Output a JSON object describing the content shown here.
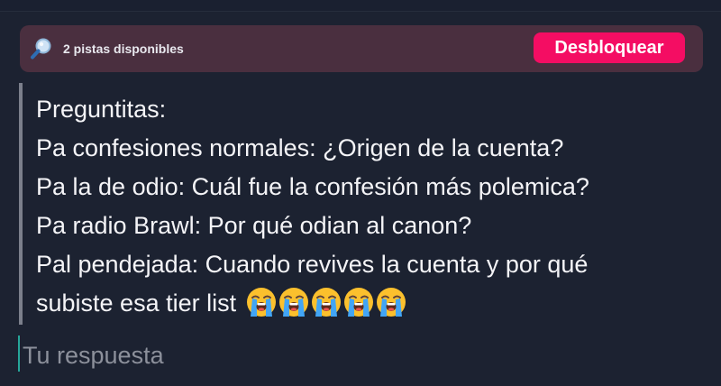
{
  "hints": {
    "icon": "magnifying-glass-icon",
    "label": "2 pistas disponibles",
    "unlock_label": "Desbloquear"
  },
  "question": {
    "lines": [
      "Preguntitas:",
      "Pa confesiones normales: ¿Origen de la cuenta?",
      "Pa la de odio: Cuál fue la confesión más polemica?",
      "Pa radio Brawl: Por qué odian al canon?",
      "Pal pendejada: Cuando revives la cuenta y por qué",
      "subiste esa tier list"
    ],
    "trailing_emoji": "loudly-crying-face-emoji",
    "trailing_emoji_count": 5
  },
  "answer": {
    "value": "",
    "placeholder": "Tu respuesta"
  },
  "colors": {
    "background": "#1c2231",
    "hints_bar": "#4a2f3f",
    "accent": "#f40d63",
    "caret": "#26a69a",
    "quote_bar": "#7b7f8b"
  }
}
